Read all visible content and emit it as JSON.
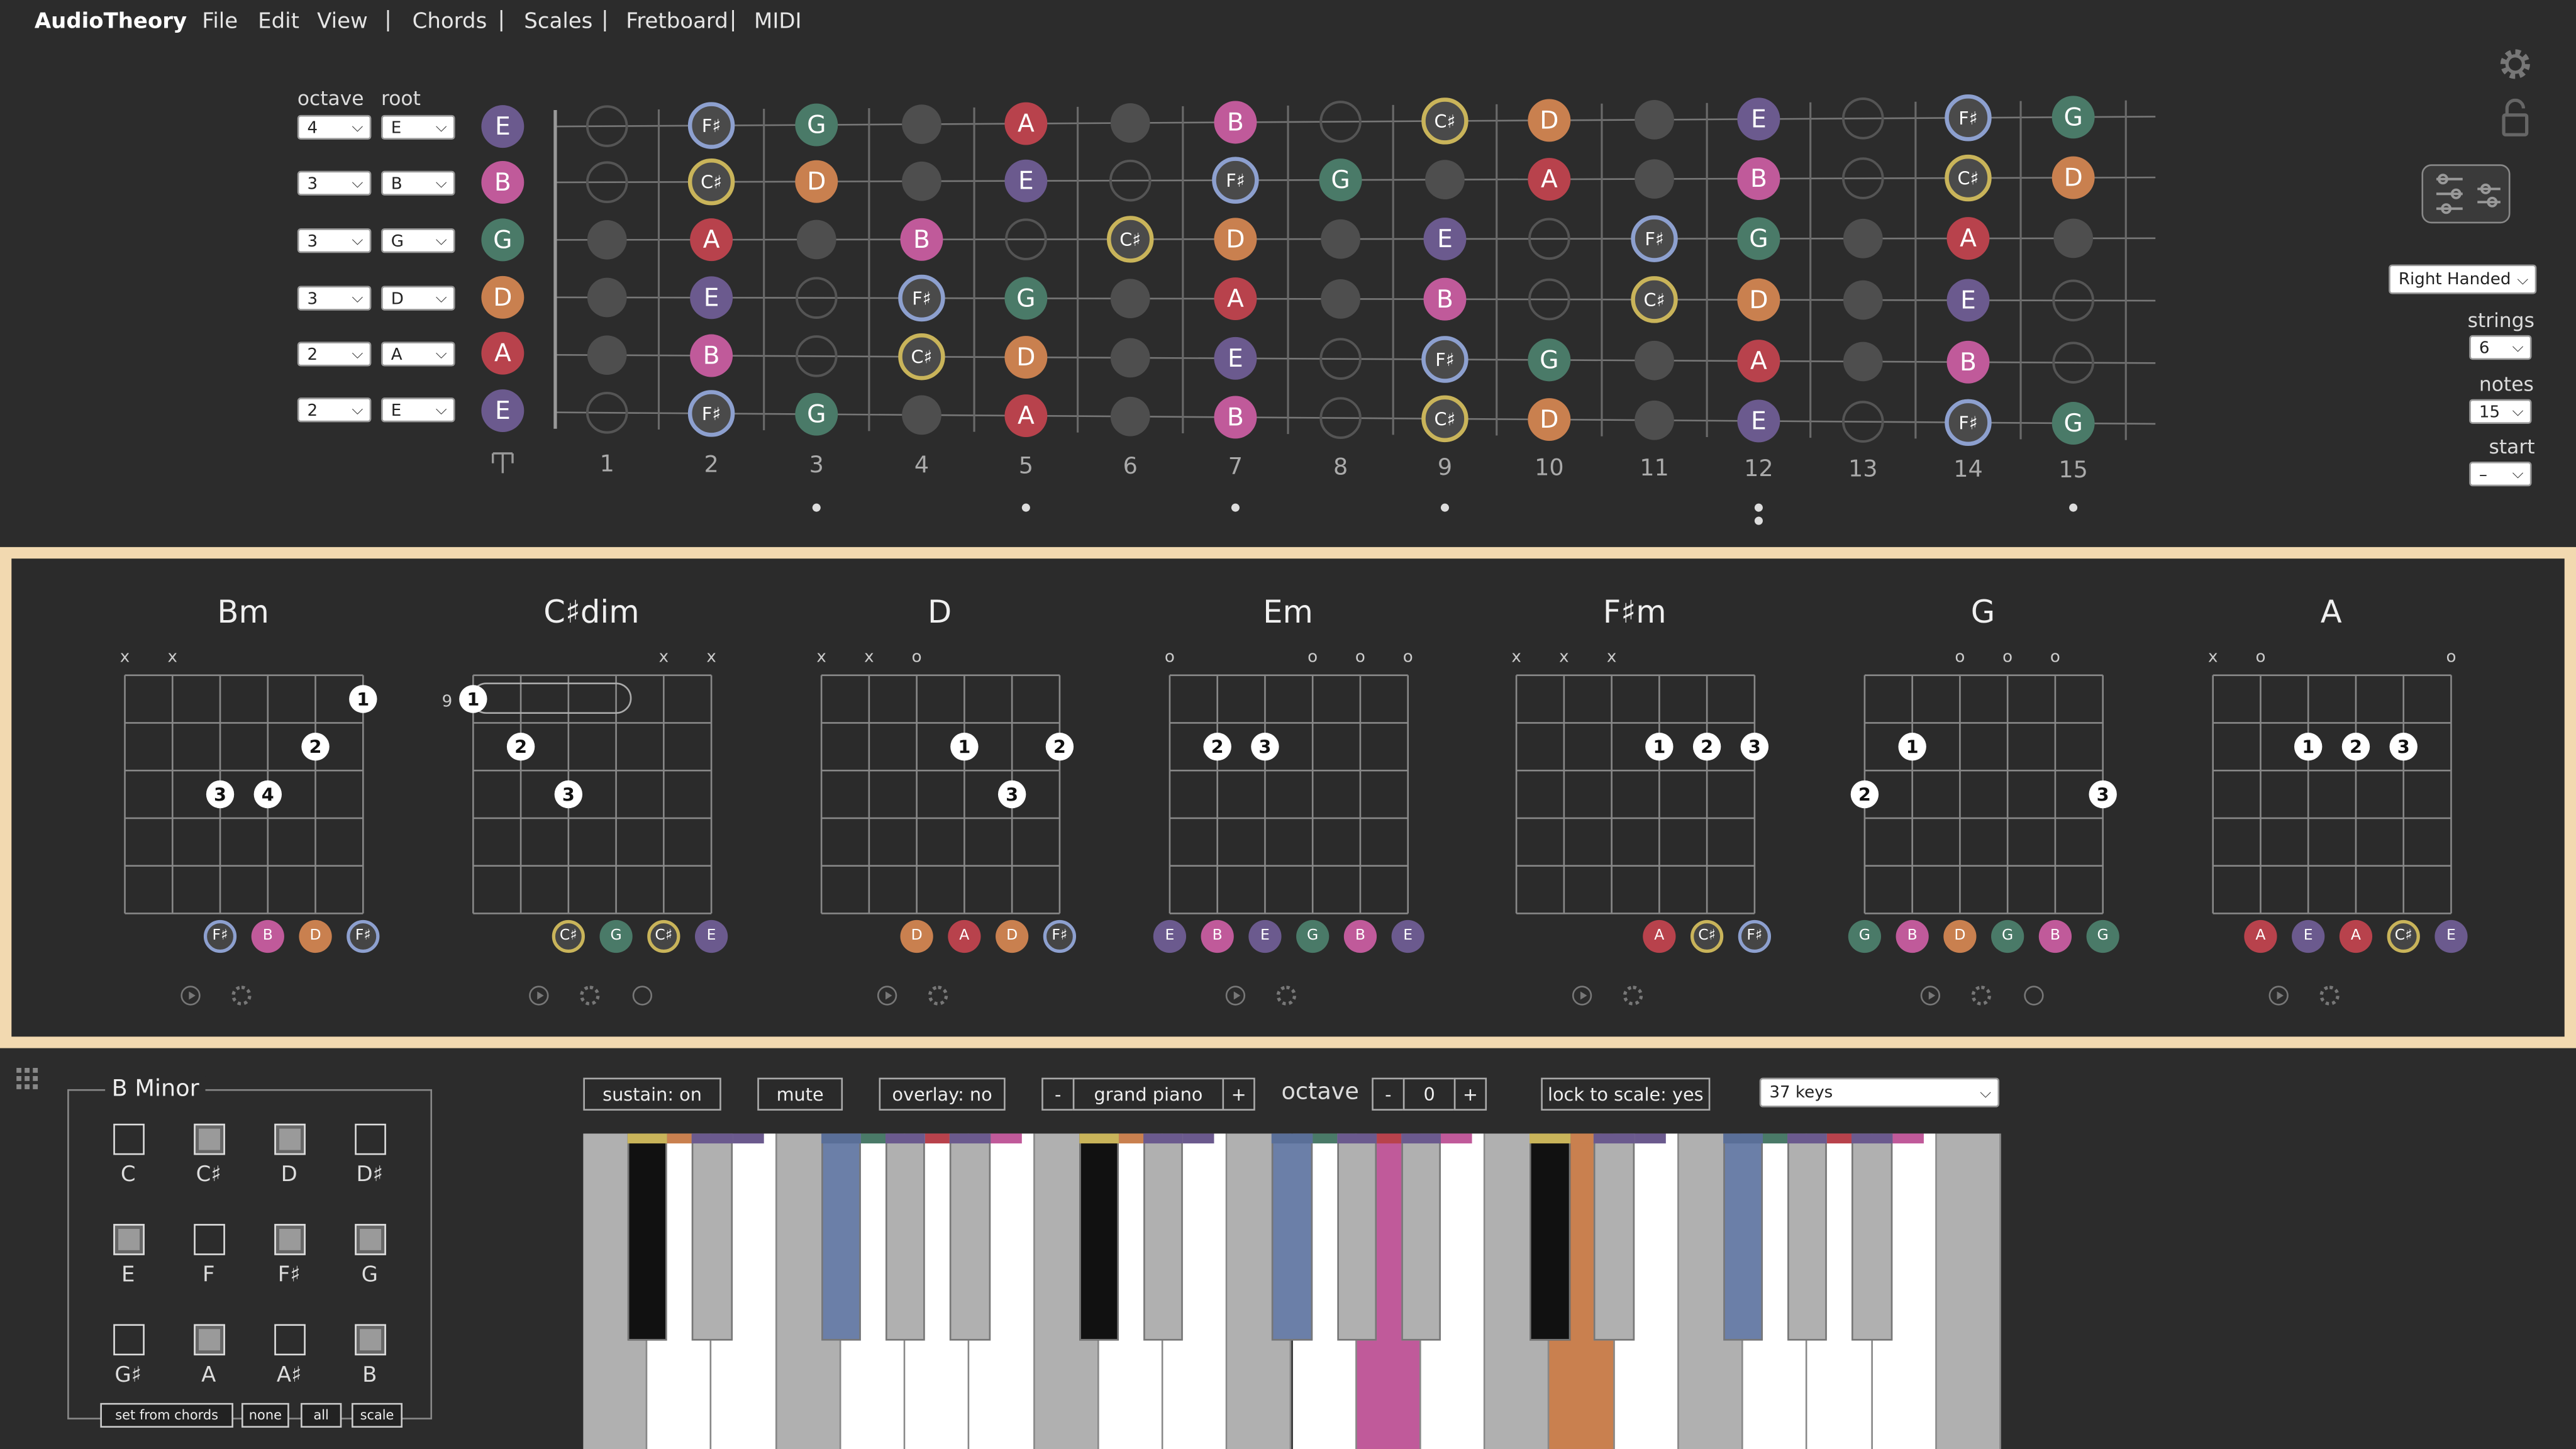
{
  "menu": {
    "app": "AudioTheory",
    "file": "File",
    "edit": "Edit",
    "view": "View",
    "chords": "Chords",
    "scales": "Scales",
    "fretboard": "Fretboard",
    "midi": "MIDI",
    "sep": "|"
  },
  "tuning": {
    "octave_label": "octave",
    "root_label": "root",
    "rows": [
      {
        "octave": "4",
        "root": "E",
        "open": "E",
        "color": "#6b5a8e"
      },
      {
        "octave": "3",
        "root": "B",
        "open": "B",
        "color": "#c05a9a"
      },
      {
        "octave": "3",
        "root": "G",
        "open": "G",
        "color": "#4a7a68"
      },
      {
        "octave": "3",
        "root": "D",
        "open": "D",
        "color": "#c9804f"
      },
      {
        "octave": "2",
        "root": "A",
        "open": "A",
        "color": "#b8424c"
      },
      {
        "octave": "2",
        "root": "E",
        "open": "E",
        "color": "#6b5a8e"
      }
    ],
    "nut_icon": "tuning-fork-icon"
  },
  "fret_numbers": [
    "1",
    "2",
    "3",
    "4",
    "5",
    "6",
    "7",
    "8",
    "9",
    "10",
    "11",
    "12",
    "13",
    "14",
    "15"
  ],
  "right_panel": {
    "handed": "Right Handed",
    "strings_label": "strings",
    "strings": "6",
    "notes_label": "notes",
    "notes": "15",
    "start_label": "start",
    "start": "–"
  },
  "colors": {
    "E": "#6b5a8e",
    "B": "#c05a9a",
    "G": "#4a7a68",
    "D": "#c9804f",
    "A": "#b8424c",
    "F#": "#4a4a5a",
    "C#": "#4a4a3a",
    "accent": "#f2d9b0"
  },
  "chords": [
    {
      "name": "Bm",
      "notes": [
        "F♯",
        "B",
        "D",
        "F♯"
      ]
    },
    {
      "name": "C♯dim",
      "notes": [
        "C♯",
        "G",
        "C♯",
        "E"
      ],
      "fret": "9"
    },
    {
      "name": "D",
      "notes": [
        "D",
        "A",
        "D",
        "F♯"
      ]
    },
    {
      "name": "Em",
      "notes": [
        "E",
        "B",
        "E",
        "G",
        "B",
        "E"
      ]
    },
    {
      "name": "F♯m",
      "notes": [
        "A",
        "C♯",
        "F♯"
      ]
    },
    {
      "name": "G",
      "notes": [
        "G",
        "B",
        "D",
        "G",
        "B",
        "G"
      ]
    },
    {
      "name": "A",
      "notes": [
        "A",
        "E",
        "A",
        "C♯",
        "E"
      ]
    }
  ],
  "scale": {
    "title": "B Minor",
    "notes": [
      {
        "n": "C",
        "on": false
      },
      {
        "n": "C♯",
        "on": true
      },
      {
        "n": "D",
        "on": true
      },
      {
        "n": "D♯",
        "on": false
      },
      {
        "n": "E",
        "on": true
      },
      {
        "n": "F",
        "on": false
      },
      {
        "n": "F♯",
        "on": true
      },
      {
        "n": "G",
        "on": true
      },
      {
        "n": "G♯",
        "on": false
      },
      {
        "n": "A",
        "on": true
      },
      {
        "n": "A♯",
        "on": false
      },
      {
        "n": "B",
        "on": true
      }
    ],
    "btn_set": "set from chords",
    "btn_none": "none",
    "btn_all": "all",
    "btn_scale": "scale"
  },
  "keyboard": {
    "sustain": "sustain: on",
    "mute": "mute",
    "overlay": "overlay: no",
    "minus": "-",
    "instrument": "grand piano",
    "plus": "+",
    "octave_label": "octave",
    "octave": "0",
    "lock": "lock to scale: yes",
    "keys": "37 keys"
  }
}
